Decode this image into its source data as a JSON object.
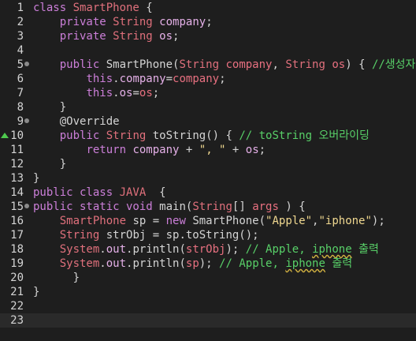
{
  "lines": [
    {
      "n": "1",
      "fold": false,
      "mark": false,
      "tokens": [
        [
          "kw",
          "class "
        ],
        [
          "ty",
          "SmartPhone"
        ],
        [
          "fn",
          " {"
        ]
      ]
    },
    {
      "n": "2",
      "fold": false,
      "mark": false,
      "tokens": [
        [
          "fn",
          "    "
        ],
        [
          "kw",
          "private "
        ],
        [
          "ty",
          "String "
        ],
        [
          "var",
          "company"
        ],
        [
          "fn",
          ";"
        ]
      ]
    },
    {
      "n": "3",
      "fold": false,
      "mark": false,
      "tokens": [
        [
          "fn",
          "    "
        ],
        [
          "kw",
          "private "
        ],
        [
          "ty",
          "String "
        ],
        [
          "var",
          "os"
        ],
        [
          "fn",
          ";"
        ]
      ]
    },
    {
      "n": "4",
      "fold": false,
      "mark": false,
      "tokens": []
    },
    {
      "n": "5",
      "fold": true,
      "mark": false,
      "tokens": [
        [
          "fn",
          "    "
        ],
        [
          "kw",
          "public "
        ],
        [
          "fn",
          "SmartPhone("
        ],
        [
          "ty",
          "String "
        ],
        [
          "pa",
          "company"
        ],
        [
          "fn",
          ", "
        ],
        [
          "ty",
          "String "
        ],
        [
          "pa",
          "os"
        ],
        [
          "fn",
          ") { "
        ],
        [
          "cm",
          "//생성자"
        ]
      ]
    },
    {
      "n": "6",
      "fold": false,
      "mark": false,
      "tokens": [
        [
          "fn",
          "        "
        ],
        [
          "kw",
          "this"
        ],
        [
          "fn",
          "."
        ],
        [
          "var",
          "company"
        ],
        [
          "fn",
          "="
        ],
        [
          "pa",
          "company"
        ],
        [
          "fn",
          ";"
        ]
      ]
    },
    {
      "n": "7",
      "fold": false,
      "mark": false,
      "tokens": [
        [
          "fn",
          "        "
        ],
        [
          "kw",
          "this"
        ],
        [
          "fn",
          "."
        ],
        [
          "var",
          "os"
        ],
        [
          "fn",
          "="
        ],
        [
          "pa",
          "os"
        ],
        [
          "fn",
          ";"
        ]
      ]
    },
    {
      "n": "8",
      "fold": false,
      "mark": false,
      "tokens": [
        [
          "fn",
          "    }"
        ]
      ]
    },
    {
      "n": "9",
      "fold": true,
      "mark": false,
      "tokens": [
        [
          "fn",
          "    "
        ],
        [
          "an",
          "@Override"
        ]
      ]
    },
    {
      "n": "10",
      "fold": false,
      "mark": true,
      "tokens": [
        [
          "fn",
          "    "
        ],
        [
          "kw",
          "public "
        ],
        [
          "ty",
          "String "
        ],
        [
          "fn",
          "toString() { "
        ],
        [
          "cm",
          "// toString 오버라이딩"
        ]
      ]
    },
    {
      "n": "11",
      "fold": false,
      "mark": false,
      "tokens": [
        [
          "fn",
          "        "
        ],
        [
          "kw",
          "return "
        ],
        [
          "var",
          "company"
        ],
        [
          "fn",
          " + "
        ],
        [
          "str",
          "\", \""
        ],
        [
          "fn",
          " + "
        ],
        [
          "var",
          "os"
        ],
        [
          "fn",
          ";"
        ]
      ]
    },
    {
      "n": "12",
      "fold": false,
      "mark": false,
      "tokens": [
        [
          "fn",
          "    }"
        ]
      ]
    },
    {
      "n": "13",
      "fold": false,
      "mark": false,
      "tokens": [
        [
          "fn",
          "}"
        ]
      ]
    },
    {
      "n": "14",
      "fold": false,
      "mark": false,
      "tokens": [
        [
          "kw",
          "public class "
        ],
        [
          "ty",
          "JAVA"
        ],
        [
          "fn",
          "  {"
        ]
      ]
    },
    {
      "n": "15",
      "fold": true,
      "mark": false,
      "tokens": [
        [
          "kw",
          "public static void "
        ],
        [
          "fn",
          "main("
        ],
        [
          "ty",
          "String"
        ],
        [
          "fn",
          "[] "
        ],
        [
          "pa",
          "args"
        ],
        [
          "fn",
          " ) {"
        ]
      ]
    },
    {
      "n": "16",
      "fold": false,
      "mark": false,
      "tokens": [
        [
          "fn",
          "    "
        ],
        [
          "ty",
          "SmartPhone "
        ],
        [
          "fn",
          "sp = "
        ],
        [
          "kw",
          "new "
        ],
        [
          "fn",
          "SmartPhone("
        ],
        [
          "str",
          "\"Apple\""
        ],
        [
          "fn",
          ","
        ],
        [
          "str",
          "\"iphone\""
        ],
        [
          "fn",
          ");"
        ]
      ]
    },
    {
      "n": "17",
      "fold": false,
      "mark": false,
      "tokens": [
        [
          "fn",
          "    "
        ],
        [
          "ty",
          "String "
        ],
        [
          "fn",
          "strObj = sp.toString();"
        ]
      ]
    },
    {
      "n": "18",
      "fold": false,
      "mark": false,
      "tokens": [
        [
          "fn",
          "    "
        ],
        [
          "ty",
          "System"
        ],
        [
          "fn",
          "."
        ],
        [
          "var",
          "out"
        ],
        [
          "fn",
          ".println("
        ],
        [
          "pa",
          "strObj"
        ],
        [
          "fn",
          "); "
        ],
        [
          "cm",
          "// Apple, "
        ],
        [
          "cmsq",
          "iphone"
        ],
        [
          "cm",
          " 출력"
        ]
      ]
    },
    {
      "n": "19",
      "fold": false,
      "mark": false,
      "tokens": [
        [
          "fn",
          "    "
        ],
        [
          "ty",
          "System"
        ],
        [
          "fn",
          "."
        ],
        [
          "var",
          "out"
        ],
        [
          "fn",
          ".println("
        ],
        [
          "pa",
          "sp"
        ],
        [
          "fn",
          "); "
        ],
        [
          "cm",
          "// Apple, "
        ],
        [
          "cmsq",
          "iphone"
        ],
        [
          "cm",
          " 출력"
        ]
      ]
    },
    {
      "n": "20",
      "fold": false,
      "mark": false,
      "tokens": [
        [
          "fn",
          "      }"
        ]
      ]
    },
    {
      "n": "21",
      "fold": false,
      "mark": false,
      "tokens": [
        [
          "fn",
          "}"
        ]
      ]
    },
    {
      "n": "22",
      "fold": false,
      "mark": false,
      "tokens": []
    },
    {
      "n": "23",
      "fold": false,
      "mark": false,
      "current": true,
      "tokens": []
    }
  ]
}
